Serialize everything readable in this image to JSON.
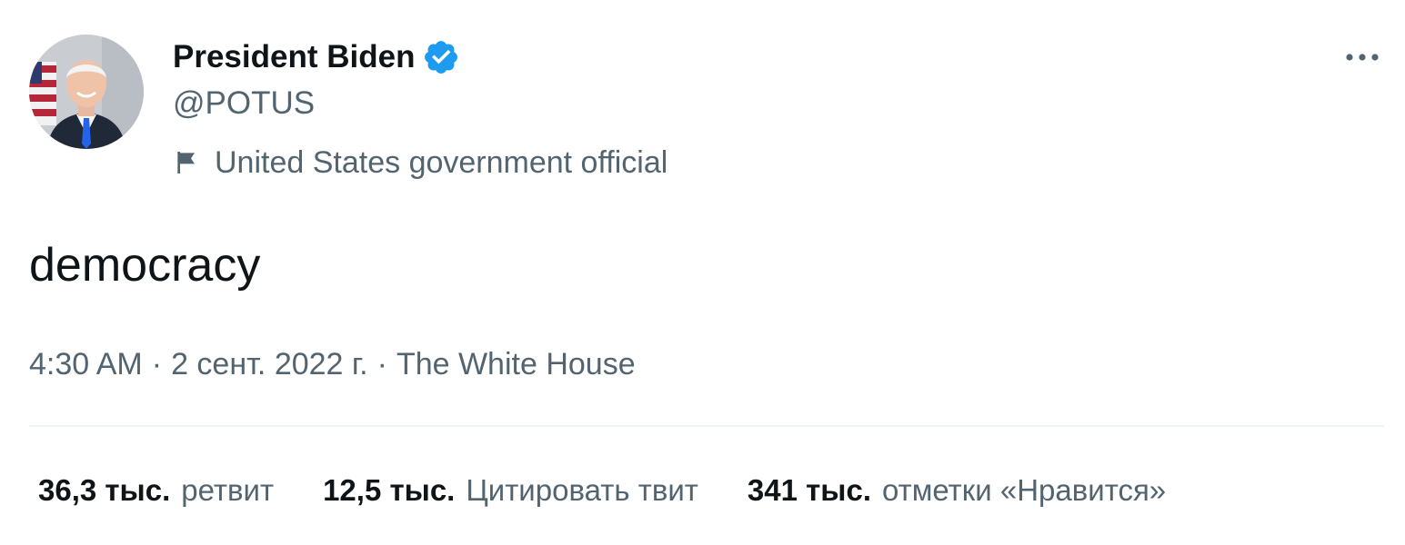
{
  "author": {
    "display_name": "President Biden",
    "handle": "@POTUS",
    "label": "United States government official",
    "verified": true,
    "verified_color": "#1d9bf0",
    "avatar": "avatar"
  },
  "icons": {
    "verified": "verified-badge-icon",
    "label": "flag-icon",
    "more": "more-horizontal-icon"
  },
  "tweet": {
    "text": "democracy"
  },
  "meta": {
    "time": "4:30 AM",
    "separator": "·",
    "date": "2 сент. 2022 г.",
    "source": "The White House"
  },
  "stats": [
    {
      "count": "36,3 тыс.",
      "label": "ретвит"
    },
    {
      "count": "12,5 тыс.",
      "label": "Цитировать твит"
    },
    {
      "count": "341 тыс.",
      "label": "отметки «Нравится»"
    }
  ],
  "colors": {
    "text_primary": "#0f1419",
    "text_secondary": "#536471",
    "divider": "#eff3f4",
    "accent": "#1d9bf0"
  }
}
